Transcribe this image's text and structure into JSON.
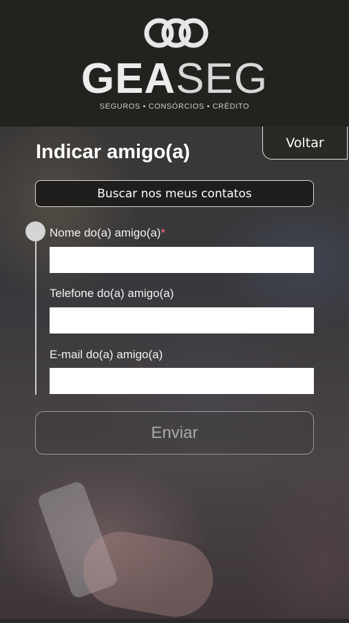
{
  "header": {
    "brand_bold": "GEA",
    "brand_light": "SEG",
    "tagline": "SEGUROS • CONSÓRCIOS • CRÉDITO"
  },
  "back_button": {
    "label": "Voltar"
  },
  "page": {
    "title": "Indicar amigo(a)"
  },
  "contacts_button": {
    "label": "Buscar nos meus contatos"
  },
  "form": {
    "name": {
      "label": "Nome do(a) amigo(a)",
      "required_mark": "*",
      "value": ""
    },
    "phone": {
      "label": "Telefone do(a) amigo(a)",
      "value": ""
    },
    "email": {
      "label": "E-mail do(a) amigo(a)",
      "value": ""
    }
  },
  "submit": {
    "label": "Enviar"
  },
  "colors": {
    "header_bg": "#24221f",
    "required": "#ff6b7a",
    "text": "#ffffff"
  }
}
